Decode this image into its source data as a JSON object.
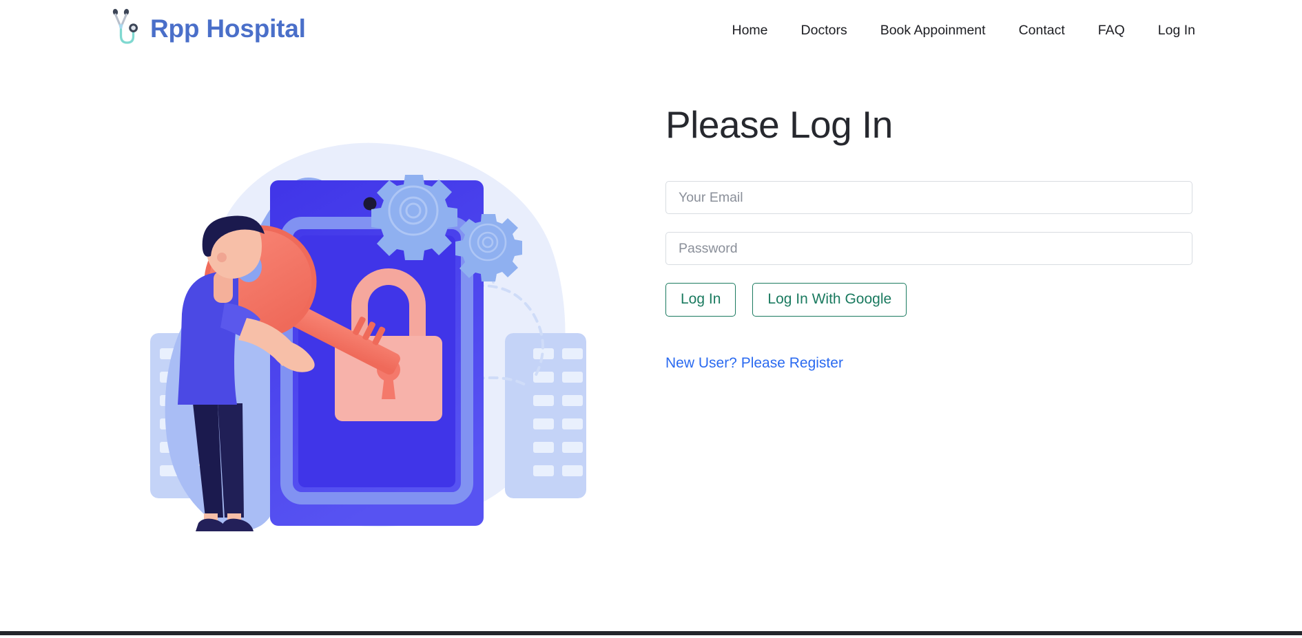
{
  "brand": {
    "name": "Rpp Hospital",
    "logo_icon": "stethoscope-icon",
    "text_color": "#4a6fc9"
  },
  "nav": {
    "items": [
      {
        "label": "Home"
      },
      {
        "label": "Doctors"
      },
      {
        "label": "Book Appoinment"
      },
      {
        "label": "Contact"
      },
      {
        "label": "FAQ"
      },
      {
        "label": "Log In"
      }
    ]
  },
  "illustration": {
    "name": "login-security-illustration",
    "description": "Man holding a large key next to a blue card with a pink padlock, gears above",
    "colors": {
      "blob_light": "#e7ecfb",
      "blob_mid": "#a9bdf5",
      "blob_dark": "#7e97ee",
      "card_deep": "#4035e8",
      "card_face": "#4f4bf0",
      "card_border": "#8192f2",
      "gear": "#8fb0f0",
      "key": "#f4796b",
      "key_dark": "#ef6a5a",
      "lock_body": "#f7b2aa",
      "lock_shackle": "#f5a79d",
      "keyhole": "#f4796b",
      "skin": "#f7bfa8",
      "hair": "#1b1a4e",
      "shirt": "#4b49e4",
      "pants": "#1b1a4e",
      "shoes": "#232059",
      "building": "#c2d2f7",
      "window": "#e7eefd"
    }
  },
  "login": {
    "title": "Please Log In",
    "email_placeholder": "Your Email",
    "email_value": "",
    "password_placeholder": "Password",
    "password_value": "",
    "login_button": "Log In",
    "google_button": "Log In With Google",
    "register_link": "New User? Please Register",
    "button_color": "#1a7a5f",
    "link_color": "#2a6af0"
  },
  "footer": {
    "bar_color": "#24262b"
  }
}
